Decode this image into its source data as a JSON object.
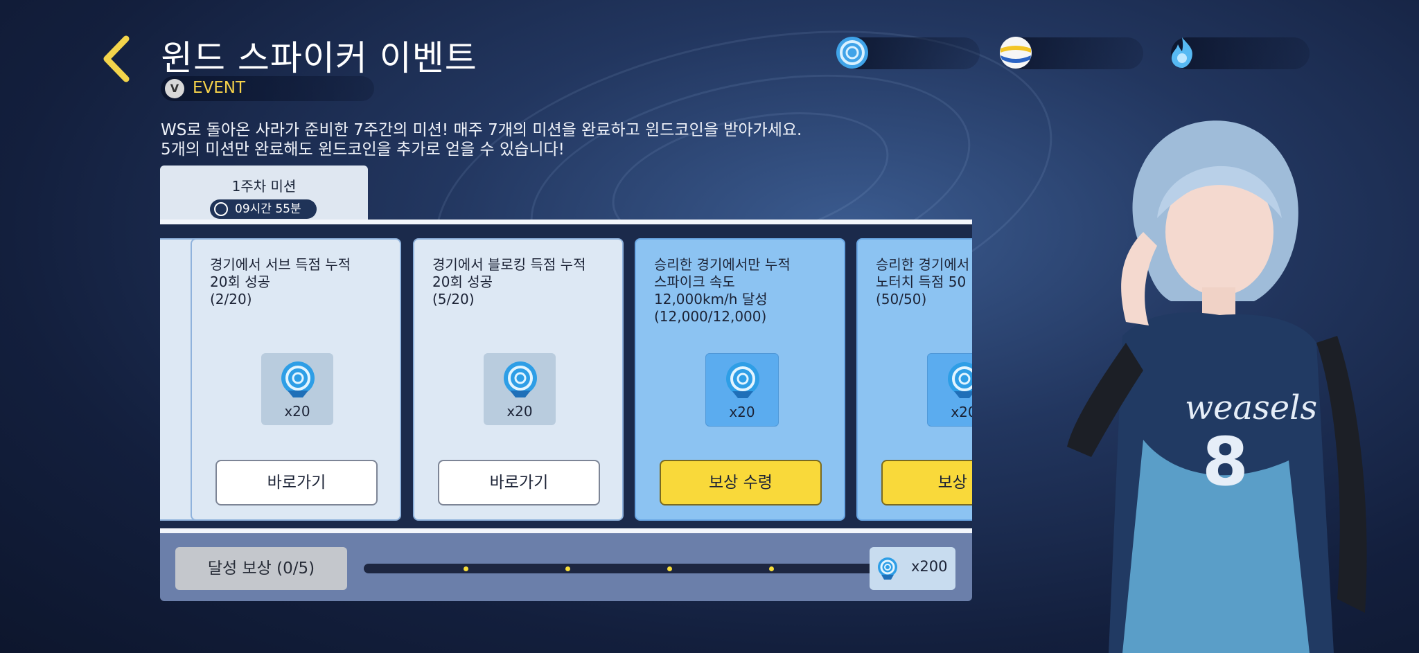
{
  "header": {
    "title": "윈드 스파이커 이벤트",
    "event_tag": "EVENT"
  },
  "currencies": [
    {
      "icon": "wind-coin-icon"
    },
    {
      "icon": "volleyball-icon"
    },
    {
      "icon": "blue-flame-icon"
    }
  ],
  "description": {
    "line1": "WS로 돌아온 사라가 준비한 7주간의 미션! 매주 7개의 미션을 완료하고 윈드코인을 받아가세요.",
    "line2": "5개의 미션만 완료해도 윈드코인을 추가로 얻을 수 있습니다!"
  },
  "tab": {
    "label": "1주차 미션",
    "timer": "09시간 55분"
  },
  "missions": [
    {
      "text": "경기에서 서브 득점 누적\n20회 성공\n(2/20)",
      "reward_qty": "x20",
      "button": "바로가기",
      "status": "pending"
    },
    {
      "text": "경기에서 블로킹 득점 누적\n20회 성공\n(5/20)",
      "reward_qty": "x20",
      "button": "바로가기",
      "status": "pending"
    },
    {
      "text": "승리한 경기에서만 누적\n스파이크 속도\n12,000km/h 달성\n(12,000/12,000)",
      "reward_qty": "x20",
      "button": "보상 수령",
      "status": "done"
    },
    {
      "text": "승리한 경기에서\n노터치 득점 50\n(50/50)",
      "reward_qty": "x20",
      "button": "보상 수",
      "status": "done"
    }
  ],
  "progress": {
    "claim_label": "달성 보상 (0/5)",
    "completed": 0,
    "total": 5,
    "final_reward_qty": "x200"
  },
  "colors": {
    "accent_yellow": "#f9d93a",
    "done_card": "#8cc3f2",
    "pending_card": "#dde8f4"
  }
}
